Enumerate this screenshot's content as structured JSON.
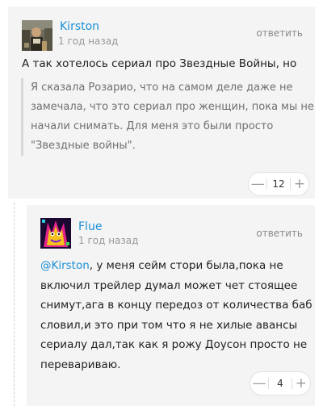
{
  "comments": [
    {
      "username": "Kirston",
      "time": "1 год назад",
      "reply_label": "ответить",
      "text": "А так хотелось сериал про Звездные Войны, но",
      "quote_lines": [
        "Я сказала Розарио, что на самом деле даже не",
        "замечала, что это сериал про женщин, пока мы не",
        "начали снимать. Для меня это были просто",
        "\"Звездные войны\"."
      ],
      "votes": "12",
      "minus_label": "—",
      "plus_label": "+"
    },
    {
      "username": "Flue",
      "time": "1 год назад",
      "reply_label": "ответить",
      "mention": "@Kirston",
      "first_line_rest": ", у меня сейм стори была,пока не",
      "text_lines": [
        "включил трейлер думал может чет стоящее",
        "снимут,ага в концу передоз от количества баб",
        "словил,и это при том что я не хилые авансы",
        "сериалу дал,так как я рожу Доусон просто не",
        "перевариваю."
      ],
      "votes": "4",
      "minus_label": "—",
      "plus_label": "+"
    }
  ],
  "colors": {
    "link": "#1a8fd6",
    "card_bg": "#f4f4f4",
    "muted": "#999999"
  },
  "icons": {
    "avatar_1": "user-photo-avatar",
    "avatar_2": "rainbow-creature-avatar"
  }
}
